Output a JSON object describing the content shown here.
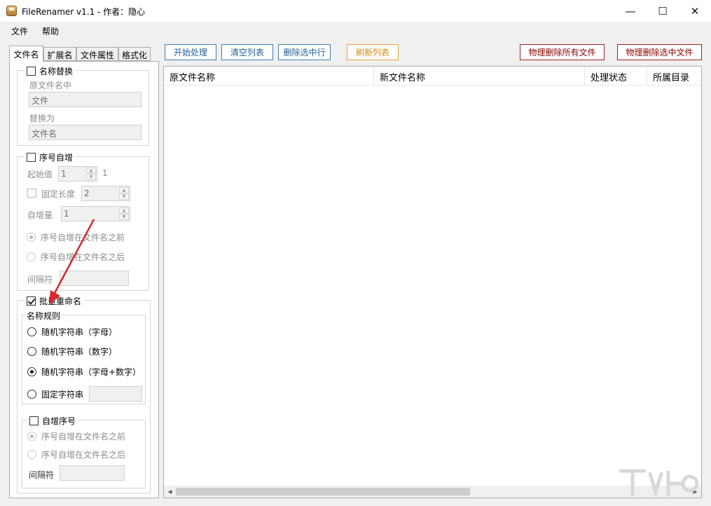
{
  "window": {
    "title": "FileRenamer v1.1 - 作者：隐心",
    "minimize": "—",
    "maximize": "☐",
    "close": "✕"
  },
  "menu": [
    "文件",
    "帮助"
  ],
  "tabs": [
    "文件名",
    "扩展名",
    "文件属性",
    "格式化"
  ],
  "name_replace": {
    "title": "名称替换",
    "checked": false,
    "find_label": "原文件名中",
    "find_value": "文件",
    "replace_label": "替换为",
    "replace_value": "文件名"
  },
  "seq_inc": {
    "title": "序号自增",
    "checked": false,
    "start_label": "起始值",
    "start_value": "1",
    "start_suffix": "1",
    "fixed_len_label": "固定长度",
    "fixed_len_value": "2",
    "step_label": "自增量",
    "step_value": "1",
    "before_label": "序号自增在文件名之前",
    "after_label": "序号自增在文件名之后",
    "sep_label": "间隔符",
    "sep_value": ""
  },
  "batch": {
    "title": "批量重命名",
    "checked": true,
    "rule_title": "名称规则",
    "opt_letters": "随机字符串（字母）",
    "opt_digits": "随机字符串（数字）",
    "opt_mixed": "随机字符串（字母+数字）",
    "opt_fixed": "固定字符串",
    "fixed_value": "",
    "selected": "mixed",
    "autoseq_title": "自增序号",
    "autoseq_checked": false,
    "autoseq_before": "序号自增在文件名之前",
    "autoseq_after": "序号自增在文件名之后",
    "autoseq_sep_label": "间隔符",
    "autoseq_sep_value": ""
  },
  "toolbar": {
    "start": "开始处理",
    "clear": "清空列表",
    "delete_selected_row": "删除选中行",
    "refresh": "刷新列表",
    "phys_delete_all": "物理删除所有文件",
    "phys_delete_selected": "物理删除选中文件"
  },
  "grid": {
    "columns": [
      "原文件名称",
      "新文件名称",
      "处理状态",
      "所属目录"
    ],
    "rows": []
  },
  "colors": {
    "blue_btn": "#1f5f99",
    "orange_btn": "#d18b16",
    "red_btn": "#8b0000",
    "arrow": "#d9262b"
  }
}
